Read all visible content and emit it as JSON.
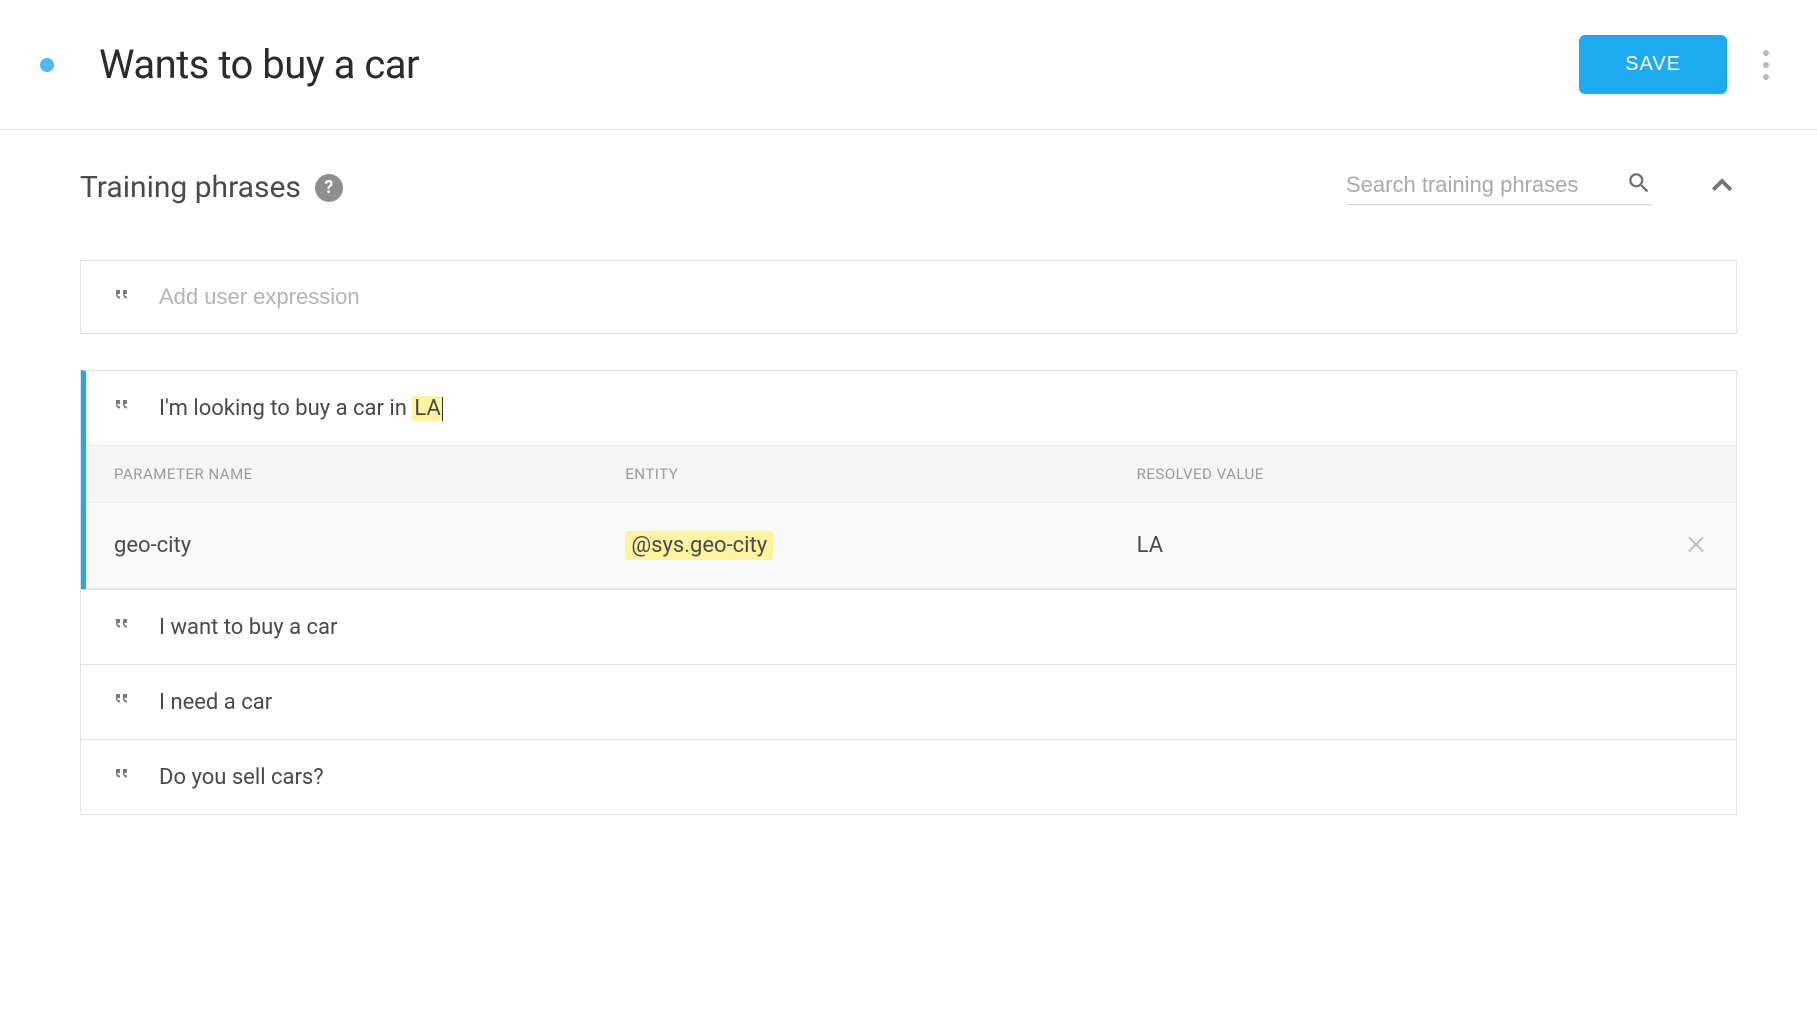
{
  "header": {
    "title": "Wants to buy a car",
    "save_label": "SAVE"
  },
  "training": {
    "section_title": "Training phrases",
    "search_placeholder": "Search training phrases",
    "add_placeholder": "Add user expression",
    "selected_phrase": {
      "prefix": "I'm looking to buy a car in ",
      "highlight": "LA"
    },
    "param_headers": {
      "name": "PARAMETER NAME",
      "entity": "ENTITY",
      "resolved": "RESOLVED VALUE"
    },
    "param_row": {
      "name": "geo-city",
      "entity": "@sys.geo-city",
      "resolved": "LA"
    },
    "phrases": [
      "I want to buy a car",
      "I need a car",
      "Do you sell cars?"
    ]
  }
}
